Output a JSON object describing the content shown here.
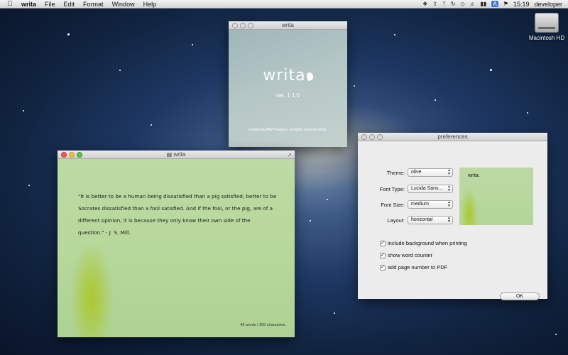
{
  "menubar": {
    "app_name": "writa",
    "menus": [
      "File",
      "Edit",
      "Format",
      "Window",
      "Help"
    ],
    "clock": "15:19",
    "user": "developer",
    "input_badge": "A"
  },
  "desktop": {
    "disk_label": "Macintosh HD"
  },
  "about_window": {
    "title": "writa",
    "logo": "writa",
    "version": "ver. 1.1.0",
    "copyright": "created by MW Products. all rights reserved 2012."
  },
  "editor_window": {
    "title": "writa",
    "lines": [
      "\"It is better to be a human being dissatisfied than a pig satisfied; better to be",
      "Socrates dissatisfied than a fool satisfied. And if the fool, or the pig, are of a",
      "different opinion, it is because they only know their own side of the",
      "question.\"  - J. S. Mill."
    ],
    "counter": "49 words / 260 characters."
  },
  "preferences_window": {
    "title": "preferences",
    "theme": {
      "label": "Theme:",
      "value": "olive"
    },
    "font_type": {
      "label": "Font Type:",
      "value": "Lucida Sans..."
    },
    "font_size": {
      "label": "Font Size:",
      "value": "medium"
    },
    "layout": {
      "label": "Layout:",
      "value": "horizontal"
    },
    "preview_text": "writa.",
    "options": [
      {
        "label": "include background when printing",
        "checked": true
      },
      {
        "label": "show word counter",
        "checked": true
      },
      {
        "label": "add page number to PDF",
        "checked": true
      }
    ],
    "ok_label": "OK"
  },
  "colors": {
    "olive_theme_bg": "#b7d89b",
    "about_bg": "#b4c6c5",
    "desktop_bg": "#1e3863"
  }
}
